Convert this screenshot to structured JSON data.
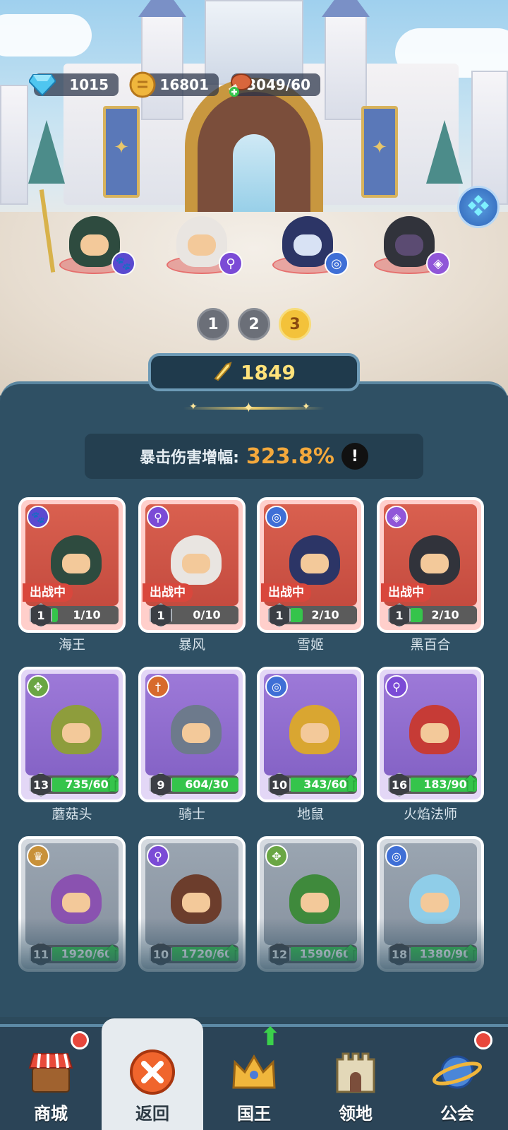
{
  "currency": {
    "gems": "1015",
    "coins": "16801",
    "stamina": "3049/60"
  },
  "lineup": {
    "pages": [
      "1",
      "2",
      "3"
    ],
    "active_page": "3",
    "heroes": [
      {
        "badge_icon": "paw-icon",
        "badge_color": "#5a4ad0"
      },
      {
        "badge_icon": "staff-icon",
        "badge_color": "#7b4bd6"
      },
      {
        "badge_icon": "swirl-icon",
        "badge_color": "#3f6fd6"
      },
      {
        "badge_icon": "eye-icon",
        "badge_color": "#9056d8"
      }
    ]
  },
  "power": {
    "value": "1849",
    "icon": "sword-icon"
  },
  "crit": {
    "label": "暴击伤害增幅:",
    "value": "323.8%",
    "info": "!"
  },
  "cards": [
    {
      "name": "海王",
      "level": "1",
      "progress": "1/10",
      "fill": 0.1,
      "status": "出战中",
      "rarity": "red",
      "badge_icon": "paw-icon",
      "badge_color": "#5a4ad0",
      "upgrade": false,
      "char_color": "#2e4b3f"
    },
    {
      "name": "暴风",
      "level": "1",
      "progress": "0/10",
      "fill": 0.0,
      "status": "出战中",
      "rarity": "red",
      "badge_icon": "staff-icon",
      "badge_color": "#7b4bd6",
      "upgrade": false,
      "char_color": "#e9e5e1"
    },
    {
      "name": "雪姬",
      "level": "1",
      "progress": "2/10",
      "fill": 0.2,
      "status": "出战中",
      "rarity": "red",
      "badge_icon": "swirl-icon",
      "badge_color": "#3f6fd6",
      "upgrade": false,
      "char_color": "#2c3566"
    },
    {
      "name": "黑百合",
      "level": "1",
      "progress": "2/10",
      "fill": 0.2,
      "status": "出战中",
      "rarity": "red",
      "badge_icon": "eye-icon",
      "badge_color": "#9056d8",
      "upgrade": false,
      "char_color": "#31333b"
    },
    {
      "name": "蘑菇头",
      "level": "13",
      "progress": "735/60",
      "fill": 1.0,
      "status": "",
      "rarity": "purple",
      "badge_icon": "arrows-icon",
      "badge_color": "#6aa644",
      "upgrade": true,
      "char_color": "#8e9d3c"
    },
    {
      "name": "骑士",
      "level": "9",
      "progress": "604/30",
      "fill": 1.0,
      "status": "",
      "rarity": "purple",
      "badge_icon": "sword-icon",
      "badge_color": "#d76a2c",
      "upgrade": false,
      "char_color": "#6d7a8c"
    },
    {
      "name": "地鼠",
      "level": "10",
      "progress": "343/60",
      "fill": 1.0,
      "status": "",
      "rarity": "purple",
      "badge_icon": "swirl-icon",
      "badge_color": "#3f6fd6",
      "upgrade": true,
      "char_color": "#d9a631"
    },
    {
      "name": "火焰法师",
      "level": "16",
      "progress": "183/90",
      "fill": 1.0,
      "status": "",
      "rarity": "purple",
      "badge_icon": "staff-icon",
      "badge_color": "#7b4bd6",
      "upgrade": true,
      "char_color": "#c63b36"
    },
    {
      "name": "",
      "level": "11",
      "progress": "1920/60",
      "fill": 1.0,
      "status": "",
      "rarity": "gray",
      "badge_icon": "crown-icon",
      "badge_color": "#c8913a",
      "upgrade": true,
      "char_color": "#8a52b0"
    },
    {
      "name": "",
      "level": "10",
      "progress": "1720/60",
      "fill": 1.0,
      "status": "",
      "rarity": "gray",
      "badge_icon": "staff-icon",
      "badge_color": "#7b4bd6",
      "upgrade": true,
      "char_color": "#6c3d2c"
    },
    {
      "name": "",
      "level": "12",
      "progress": "1590/60",
      "fill": 1.0,
      "status": "",
      "rarity": "gray",
      "badge_icon": "arrows-icon",
      "badge_color": "#6aa644",
      "upgrade": true,
      "char_color": "#3f8a3c"
    },
    {
      "name": "",
      "level": "18",
      "progress": "1380/90",
      "fill": 1.0,
      "status": "",
      "rarity": "gray",
      "badge_icon": "swirl-icon",
      "badge_color": "#3f6fd6",
      "upgrade": true,
      "char_color": "#8fcde8"
    }
  ],
  "nav": [
    {
      "label": "商城",
      "icon": "shop-icon",
      "badge": "red-dot"
    },
    {
      "label": "返回",
      "icon": "close-icon",
      "badge": "",
      "active": true
    },
    {
      "label": "国王",
      "icon": "crown-icon",
      "badge": "green-up"
    },
    {
      "label": "领地",
      "icon": "castle-icon",
      "badge": ""
    },
    {
      "label": "公会",
      "icon": "planet-icon",
      "badge": "red-dot"
    }
  ]
}
